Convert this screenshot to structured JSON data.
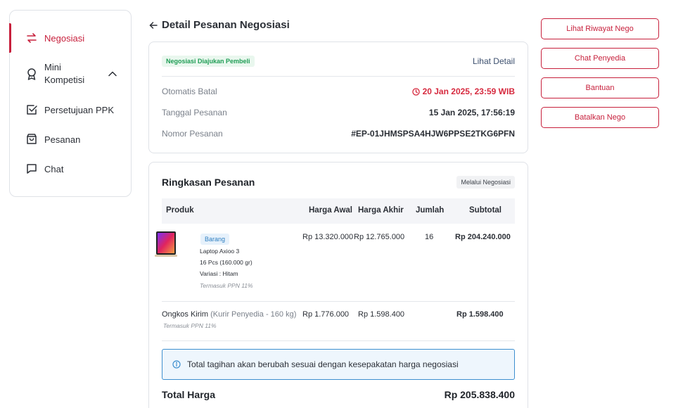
{
  "sidebar": {
    "items": [
      {
        "label": "Negosiasi",
        "icon": "swap-arrows-icon"
      },
      {
        "label": "Mini Kompetisi",
        "icon": "award-ribbon-icon"
      },
      {
        "label": "Persetujuan PPK",
        "icon": "checkbox-icon"
      },
      {
        "label": "Pesanan",
        "icon": "shopping-bag-icon"
      },
      {
        "label": "Chat",
        "icon": "chat-bubble-icon"
      }
    ]
  },
  "header": {
    "title": "Detail Pesanan Negosiasi"
  },
  "order_info": {
    "status_badge": "Negosiasi Diajukan Pembeli",
    "detail_link": "Lihat Detail",
    "auto_cancel_label": "Otomatis Batal",
    "auto_cancel_value": "20 Jan 2025, 23:59 WIB",
    "order_date_label": "Tanggal Pesanan",
    "order_date_value": "15 Jan 2025, 17:56:19",
    "order_number_label": "Nomor Pesanan",
    "order_number_value": "#EP-01JHMSPSA4HJW6PPSE2TKG6PFN"
  },
  "summary": {
    "title": "Ringkasan Pesanan",
    "badge": "Melalui Negosiasi",
    "columns": [
      "Produk",
      "Harga Awal",
      "Harga Akhir",
      "Jumlah",
      "Subtotal"
    ],
    "product": {
      "type_badge": "Barang",
      "name": "Laptop Axioo 3",
      "qty_weight": "16 Pcs (160.000 gr)",
      "variant": "Variasi   : Hitam",
      "tax_note": "Termasuk PPN 11%",
      "initial_price": "Rp 13.320.000",
      "final_price": "Rp 12.765.000",
      "quantity": "16",
      "subtotal": "Rp 204.240.000"
    },
    "shipping": {
      "label": "Ongkos Kirim",
      "courier": "(Kurir Penyedia - 160 kg)",
      "tax_note": "Termasuk PPN 11%",
      "initial_price": "Rp 1.776.000",
      "final_price": "Rp 1.598.400",
      "subtotal": "Rp 1.598.400"
    },
    "alert": "Total tagihan akan berubah sesuai dengan kesepakatan harga negosiasi",
    "total_label": "Total Harga",
    "total_value": "Rp 205.838.400"
  },
  "actions": {
    "history": "Lihat Riwayat Nego",
    "chat": "Chat Penyedia",
    "help": "Bantuan",
    "cancel": "Batalkan Nego"
  },
  "colors": {
    "accent": "#c7203c",
    "success": "#1f9d55",
    "info": "#3d8fcf"
  }
}
